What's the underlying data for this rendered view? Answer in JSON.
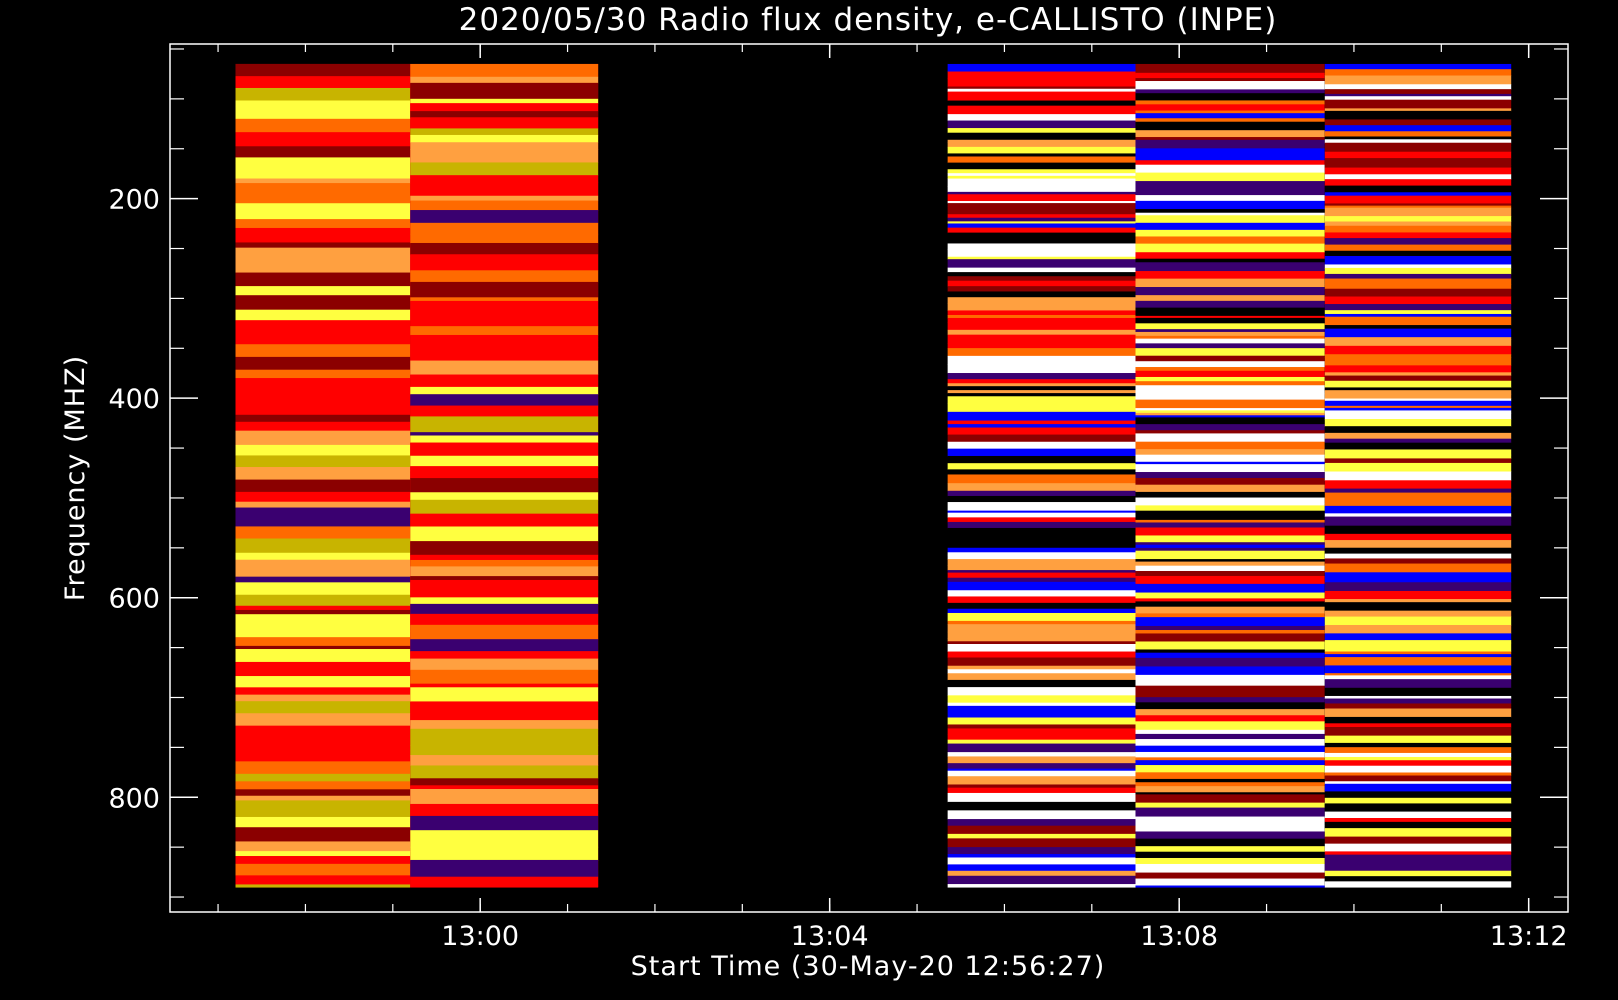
{
  "chart_data": {
    "type": "heatmap",
    "title": "2020/05/30  Radio flux density, e-CALLISTO (INPE)",
    "xlabel": "Start Time (30-May-20 12:56:27)",
    "ylabel": "Frequency (MHZ)",
    "x_unit": "minutes",
    "x_start": "12:56:27",
    "xlim": [
      "12:56:27",
      "13:12:27"
    ],
    "ylim": [
      45,
      915
    ],
    "y_inverted": true,
    "x_ticks": [
      "13:00",
      "13:04",
      "13:08",
      "13:12"
    ],
    "y_ticks": [
      200,
      400,
      600,
      800
    ],
    "grid": false,
    "colormap": [
      "#000000",
      "#3a0070",
      "#0000ff",
      "#8b0000",
      "#ff0000",
      "#ff6a00",
      "#ffa040",
      "#c8b400",
      "#ffff40",
      "#ffffff"
    ],
    "segments": [
      {
        "start": "12:57:12",
        "end": "12:59:12",
        "freq_range": [
          65,
          890
        ],
        "pattern": "smooth"
      },
      {
        "start": "12:59:12",
        "end": "13:01:21",
        "freq_range": [
          65,
          890
        ],
        "pattern": "smooth"
      },
      {
        "start": "13:05:21",
        "end": "13:07:30",
        "freq_range": [
          65,
          890
        ],
        "pattern": "noisy"
      },
      {
        "start": "13:07:30",
        "end": "13:09:40",
        "freq_range": [
          65,
          890
        ],
        "pattern": "noisy"
      },
      {
        "start": "13:09:40",
        "end": "13:11:48",
        "freq_range": [
          65,
          890
        ],
        "pattern": "noisy"
      }
    ]
  }
}
